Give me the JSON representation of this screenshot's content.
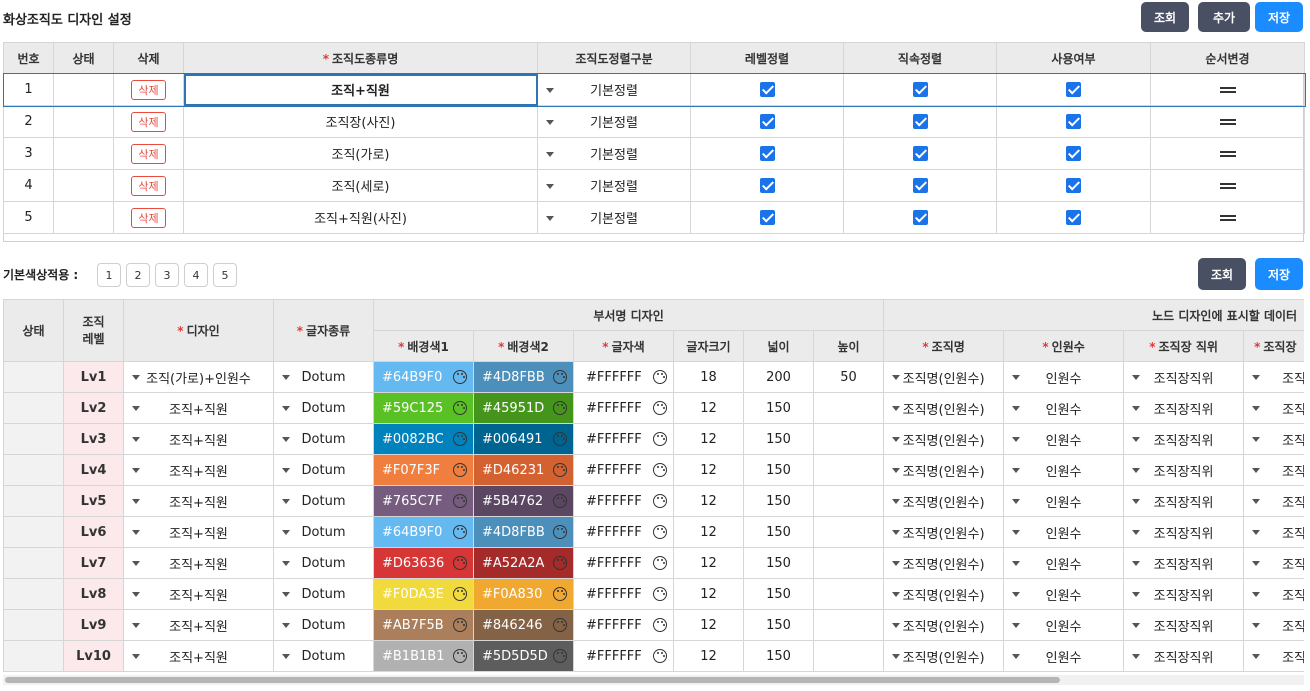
{
  "page_title": "화상조직도 디자인 설정",
  "top_buttons": {
    "search": "조회",
    "add": "추가",
    "save": "저장"
  },
  "grid1": {
    "headers": {
      "no": "번호",
      "state": "상태",
      "delete": "삭제",
      "org_type": "조직도종류명",
      "sort_type": "조직도정렬구분",
      "level_sort": "레벨정렬",
      "direct_sort": "직속정렬",
      "use": "사용여부",
      "order": "순서변경"
    },
    "rows": [
      {
        "no": "1",
        "delete": "삭제",
        "name": "조직+직원",
        "sort": "기본정렬",
        "level": true,
        "direct": true,
        "use": true
      },
      {
        "no": "2",
        "delete": "삭제",
        "name": "조직장(사진)",
        "sort": "기본정렬",
        "level": true,
        "direct": true,
        "use": true
      },
      {
        "no": "3",
        "delete": "삭제",
        "name": "조직(가로)",
        "sort": "기본정렬",
        "level": true,
        "direct": true,
        "use": true
      },
      {
        "no": "4",
        "delete": "삭제",
        "name": "조직(세로)",
        "sort": "기본정렬",
        "level": true,
        "direct": true,
        "use": true
      },
      {
        "no": "5",
        "delete": "삭제",
        "name": "조직+직원(사진)",
        "sort": "기본정렬",
        "level": true,
        "direct": true,
        "use": true
      }
    ]
  },
  "section2": {
    "label": "기본색상적용 :",
    "preset_buttons": [
      "1",
      "2",
      "3",
      "4",
      "5"
    ],
    "search": "조회",
    "save": "저장"
  },
  "grid2": {
    "headers": {
      "state": "상태",
      "level": "조직\n레벨",
      "design": "디자인",
      "font": "글자종류",
      "dept_group": "부서명 디자인",
      "bg1": "배경색1",
      "bg2": "배경색2",
      "font_color": "글자색",
      "font_size": "글자크기",
      "width": "넓이",
      "height": "높이",
      "node_group": "노드 디자인에 표시할 데이터",
      "org_name": "조직명",
      "headcount": "인원수",
      "leader_pos": "조직장 직위",
      "next": "조직장"
    },
    "rows": [
      {
        "level": "Lv1",
        "design": "조직(가로)+인원수",
        "font": "Dotum",
        "bg1": "#64B9F0",
        "bg2": "#4D8FBB",
        "fc": "#FFFFFF",
        "size": "18",
        "width": "200",
        "height": "50",
        "org": "조직명(인원수)",
        "cnt": "인원수",
        "pos": "조직장직위",
        "more": "조직"
      },
      {
        "level": "Lv2",
        "design": "조직+직원",
        "font": "Dotum",
        "bg1": "#59C125",
        "bg2": "#45951D",
        "fc": "#FFFFFF",
        "size": "12",
        "width": "150",
        "height": "",
        "org": "조직명(인원수)",
        "cnt": "인원수",
        "pos": "조직장직위",
        "more": "조직"
      },
      {
        "level": "Lv3",
        "design": "조직+직원",
        "font": "Dotum",
        "bg1": "#0082BC",
        "bg2": "#006491",
        "fc": "#FFFFFF",
        "size": "12",
        "width": "150",
        "height": "",
        "org": "조직명(인원수)",
        "cnt": "인원수",
        "pos": "조직장직위",
        "more": "조직"
      },
      {
        "level": "Lv4",
        "design": "조직+직원",
        "font": "Dotum",
        "bg1": "#F07F3F",
        "bg2": "#D46231",
        "fc": "#FFFFFF",
        "size": "12",
        "width": "150",
        "height": "",
        "org": "조직명(인원수)",
        "cnt": "인원수",
        "pos": "조직장직위",
        "more": "조직"
      },
      {
        "level": "Lv5",
        "design": "조직+직원",
        "font": "Dotum",
        "bg1": "#765C7F",
        "bg2": "#5B4762",
        "fc": "#FFFFFF",
        "size": "12",
        "width": "150",
        "height": "",
        "org": "조직명(인원수)",
        "cnt": "인원수",
        "pos": "조직장직위",
        "more": "조직"
      },
      {
        "level": "Lv6",
        "design": "조직+직원",
        "font": "Dotum",
        "bg1": "#64B9F0",
        "bg2": "#4D8FBB",
        "fc": "#FFFFFF",
        "size": "12",
        "width": "150",
        "height": "",
        "org": "조직명(인원수)",
        "cnt": "인원수",
        "pos": "조직장직위",
        "more": "조직"
      },
      {
        "level": "Lv7",
        "design": "조직+직원",
        "font": "Dotum",
        "bg1": "#D63636",
        "bg2": "#A52A2A",
        "fc": "#FFFFFF",
        "size": "12",
        "width": "150",
        "height": "",
        "org": "조직명(인원수)",
        "cnt": "인원수",
        "pos": "조직장직위",
        "more": "조직"
      },
      {
        "level": "Lv8",
        "design": "조직+직원",
        "font": "Dotum",
        "bg1": "#F0DA3E",
        "bg2": "#F0A830",
        "fc": "#FFFFFF",
        "size": "12",
        "width": "150",
        "height": "",
        "org": "조직명(인원수)",
        "cnt": "인원수",
        "pos": "조직장직위",
        "more": "조직"
      },
      {
        "level": "Lv9",
        "design": "조직+직원",
        "font": "Dotum",
        "bg1": "#AB7F5B",
        "bg2": "#846246",
        "fc": "#FFFFFF",
        "size": "12",
        "width": "150",
        "height": "",
        "org": "조직명(인원수)",
        "cnt": "인원수",
        "pos": "조직장직위",
        "more": "조직"
      },
      {
        "level": "Lv10",
        "design": "조직+직원",
        "font": "Dotum",
        "bg1": "#B1B1B1",
        "bg2": "#5D5D5D",
        "fc": "#FFFFFF",
        "size": "12",
        "width": "150",
        "height": "",
        "org": "조직명(인원수)",
        "cnt": "인원수",
        "pos": "조직장직위",
        "more": "조직"
      }
    ]
  },
  "colors": {
    "dark_button": "#4a5064",
    "blue_button": "#1a8cff",
    "required": "#e53935",
    "checkbox": "#1a73e8"
  }
}
